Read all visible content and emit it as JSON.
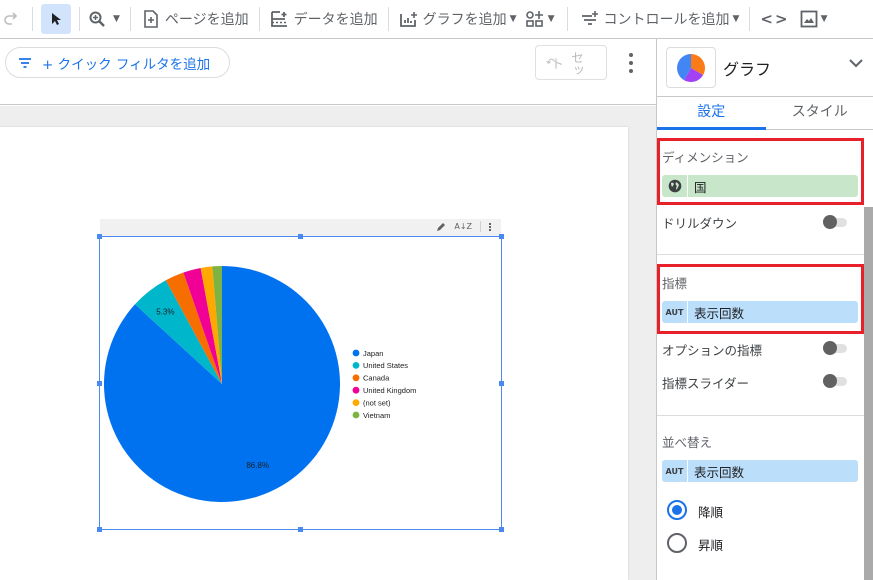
{
  "toolbar": {
    "add_page": "ページを追加",
    "add_data": "データを追加",
    "add_chart": "グラフを追加",
    "add_control": "コントロールを追加"
  },
  "filterbar": {
    "quick_filter": "+ クイック フィルタを追加",
    "reset": "セット"
  },
  "panel": {
    "title": "グラフ",
    "tabs": [
      {
        "label": "設定",
        "active": true
      },
      {
        "label": "スタイル",
        "active": false
      }
    ],
    "dimension": {
      "label": "ディメンション",
      "field": "国",
      "icon": "globe-icon"
    },
    "drilldown": {
      "label": "ドリルダウン",
      "on": false
    },
    "metric": {
      "label": "指標",
      "field": "表示回数",
      "type_badge": "AUT"
    },
    "optional_metrics": {
      "label": "オプションの指標",
      "on": false
    },
    "metric_slider": {
      "label": "指標スライダー",
      "on": false
    },
    "sort": {
      "label": "並べ替え",
      "field": "表示回数",
      "type_badge": "AUT",
      "options": [
        {
          "label": "降順",
          "selected": true
        },
        {
          "label": "昇順",
          "selected": false
        }
      ]
    },
    "highlight_color": "#e8202a"
  },
  "chart_data": {
    "type": "pie",
    "title": "",
    "legend_position": "right",
    "categories": [
      "Japan",
      "United States",
      "Canada",
      "United Kingdom",
      "(not set)",
      "Vietnam"
    ],
    "values": [
      86.8,
      5.3,
      2.6,
      2.4,
      1.6,
      1.3
    ],
    "colors": [
      "#0072f0",
      "#00b6cb",
      "#f66d00",
      "#f10096",
      "#ffa800",
      "#7cb342"
    ],
    "data_labels": [
      "86.8%",
      "5.3%",
      "",
      "",
      "",
      ""
    ],
    "unit": "%"
  }
}
